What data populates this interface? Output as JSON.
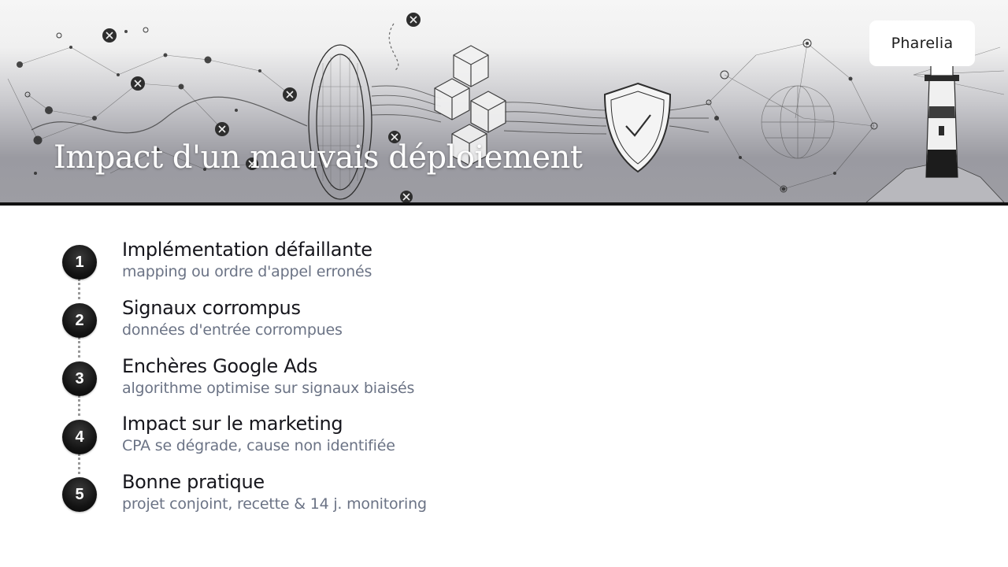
{
  "header": {
    "title": "Impact d'un mauvais déploiement",
    "logo_text": "Pharelia"
  },
  "steps": [
    {
      "number": "1",
      "title": "Implémentation défaillante",
      "description": "mapping ou ordre d'appel erronés"
    },
    {
      "number": "2",
      "title": "Signaux corrompus",
      "description": "données d'entrée corrompues"
    },
    {
      "number": "3",
      "title": "Enchères Google Ads",
      "description": "algorithme optimise sur signaux biaisés"
    },
    {
      "number": "4",
      "title": "Impact sur le marketing",
      "description": "CPA se dégrade, cause non identifiée"
    },
    {
      "number": "5",
      "title": "Bonne pratique",
      "description": "projet conjoint, recette & 14 j. monitoring"
    }
  ]
}
